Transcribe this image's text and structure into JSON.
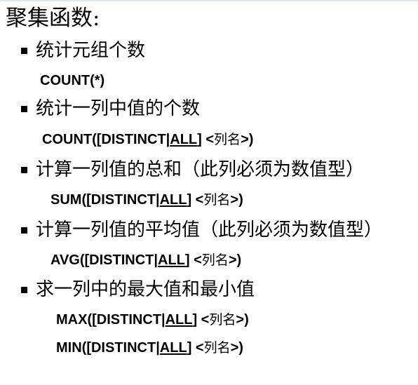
{
  "title": "聚集函数:",
  "items": [
    {
      "bullet": "统计元组个数",
      "code": [
        {
          "prefix": "COUNT(*)",
          "all": "",
          "close": "",
          "col": "",
          "end": ""
        }
      ]
    },
    {
      "bullet": "统计一列中值的个数",
      "code": [
        {
          "prefix": "COUNT([DISTINCT|",
          "all": "ALL",
          "close": "] <",
          "col": "列名",
          "end": ">)"
        }
      ]
    },
    {
      "bullet": "计算一列值的总和（此列必须为数值型）",
      "code": [
        {
          "prefix": "SUM([DISTINCT|",
          "all": "ALL",
          "close": "] <",
          "col": "列名",
          "end": ">)"
        }
      ]
    },
    {
      "bullet": "计算一列值的平均值（此列必须为数值型）",
      "code": [
        {
          "prefix": "AVG([DISTINCT|",
          "all": "ALL",
          "close": "] <",
          "col": "列名",
          "end": ">)"
        }
      ]
    },
    {
      "bullet": "求一列中的最大值和最小值",
      "code": [
        {
          "prefix": "MAX([DISTINCT|",
          "all": "ALL",
          "close": "] <",
          "col": "列名",
          "end": ">)"
        },
        {
          "prefix": "MIN([DISTINCT|",
          "all": "ALL",
          "close": "] <",
          "col": "列名",
          "end": ">)"
        }
      ]
    }
  ]
}
